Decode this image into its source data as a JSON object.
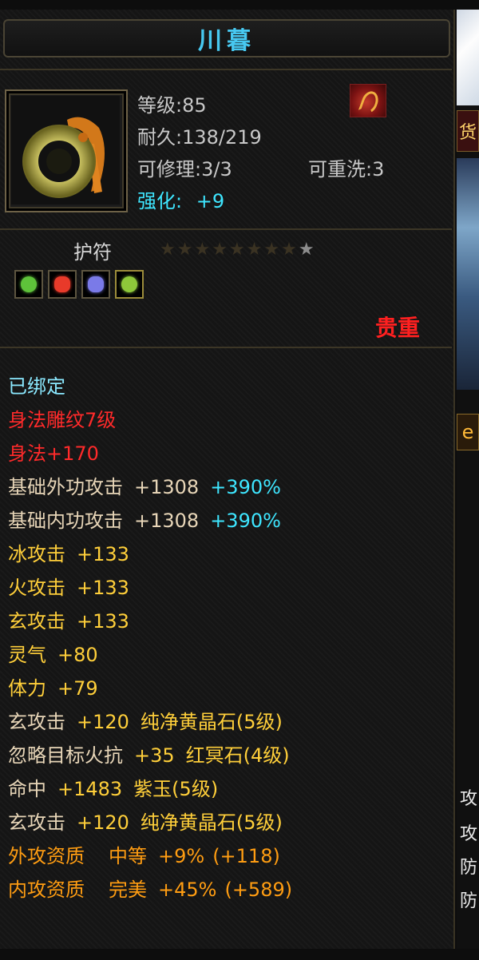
{
  "tooltip": {
    "title": "川暮",
    "level": "等级:85",
    "durability": "耐久:138/219",
    "repair": "可修理:3/3",
    "rewash": "可重洗:3",
    "enhance_label": "强化:",
    "enhance_value": "+9",
    "item_type": "护符",
    "stars_total": 9,
    "stars_lit": 1,
    "rarity": "贵重",
    "gems": [
      {
        "icon": "green-gem-icon",
        "color": "#5ec23a"
      },
      {
        "icon": "red-gem-icon",
        "color": "#e83a2a"
      },
      {
        "icon": "purple-gem-icon",
        "color": "#7a7ae8"
      },
      {
        "icon": "yellow-gem-icon",
        "color": "#8ec83a"
      }
    ]
  },
  "attributes": [
    {
      "parts": [
        "已绑定"
      ],
      "color": "cyanlight"
    },
    {
      "parts": [
        "身法雕纹7级"
      ],
      "color": "red"
    },
    {
      "parts": [
        "身法+170"
      ],
      "color": "red"
    },
    {
      "parts": [
        "基础外功攻击",
        "+1308",
        "+390%"
      ],
      "color": "tan"
    },
    {
      "parts": [
        "基础内功攻击",
        "+1308",
        "+390%"
      ],
      "color": "tan"
    },
    {
      "parts": [
        "冰攻击",
        "+133"
      ],
      "color": "yellow"
    },
    {
      "parts": [
        "火攻击",
        "+133"
      ],
      "color": "yellow"
    },
    {
      "parts": [
        "玄攻击",
        "+133"
      ],
      "color": "yellow"
    },
    {
      "parts": [
        "灵气",
        "+80"
      ],
      "color": "yellow"
    },
    {
      "parts": [
        "体力",
        "+79"
      ],
      "color": "yellow"
    },
    {
      "parts": [
        "玄攻击",
        "+120",
        "纯净黄晶石(5级)"
      ],
      "color": "mixed"
    },
    {
      "parts": [
        "忽略目标火抗",
        "+35",
        "红冥石(4级)"
      ],
      "color": "mixed"
    },
    {
      "parts": [
        "命中",
        "+1483",
        "紫玉(5级)"
      ],
      "color": "mixed"
    },
    {
      "parts": [
        "玄攻击",
        "+120",
        "纯净黄晶石(5级)"
      ],
      "color": "mixed"
    },
    {
      "parts": [
        "外攻资质",
        "中等",
        "+9%",
        "(+118)"
      ],
      "color": "orange"
    },
    {
      "parts": [
        "内攻资质",
        "完美",
        "+45%",
        "(+589)"
      ],
      "color": "orange"
    }
  ],
  "side": {
    "tab_char": "货",
    "btn_char": "e",
    "chars": [
      "攻",
      "攻",
      "防",
      "防"
    ]
  }
}
